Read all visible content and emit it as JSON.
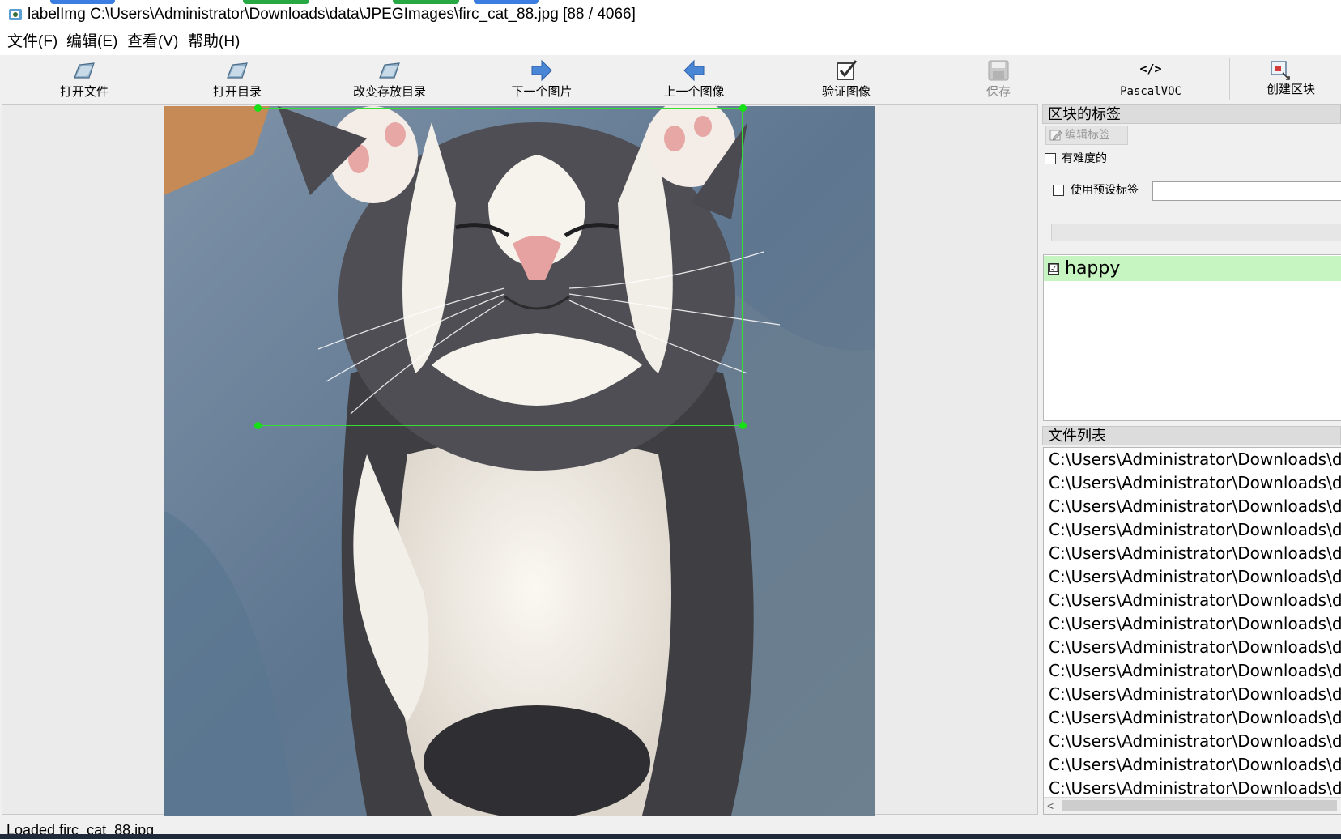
{
  "window": {
    "title": "labelImg C:\\Users\\Administrator\\Downloads\\data\\JPEGImages\\firc_cat_88.jpg [88 / 4066]",
    "app_icon": "labelimg-app-icon"
  },
  "menu": [
    {
      "label": "文件(F)"
    },
    {
      "label": "编辑(E)"
    },
    {
      "label": "查看(V)"
    },
    {
      "label": "帮助(H)"
    }
  ],
  "toolbar": {
    "open_file": {
      "label": "打开文件",
      "icon": "folder-open-icon"
    },
    "open_dir": {
      "label": "打开目录",
      "icon": "folder-open-icon"
    },
    "change_save_dir": {
      "label": "改变存放目录",
      "icon": "folder-open-icon"
    },
    "next_image": {
      "label": "下一个图片",
      "icon": "arrow-right-icon"
    },
    "prev_image": {
      "label": "上一个图像",
      "icon": "arrow-left-icon"
    },
    "verify_image": {
      "label": "验证图像",
      "icon": "checkbox-check-icon"
    },
    "save": {
      "label": "保存",
      "icon": "floppy-disk-icon",
      "enabled": false
    },
    "format": {
      "label": "PascalVOC",
      "icon_text": "</>",
      "icon": "code-icon"
    },
    "create_box": {
      "label": "创建区块",
      "icon": "create-rect-icon"
    }
  },
  "box_labels_panel": {
    "title": "区块的标签",
    "edit_label_button": "编辑标签",
    "difficult_label": "有难度的",
    "difficult_checked": false,
    "use_default_label": "使用预设标签",
    "use_default_checked": false,
    "default_label_value": "",
    "labels": [
      {
        "name": "happy",
        "checked": true,
        "checkmark": "☑"
      }
    ]
  },
  "file_list_panel": {
    "title": "文件列表",
    "items": [
      "C:\\Users\\Administrator\\Downloads\\da",
      "C:\\Users\\Administrator\\Downloads\\da",
      "C:\\Users\\Administrator\\Downloads\\da",
      "C:\\Users\\Administrator\\Downloads\\da",
      "C:\\Users\\Administrator\\Downloads\\da",
      "C:\\Users\\Administrator\\Downloads\\da",
      "C:\\Users\\Administrator\\Downloads\\da",
      "C:\\Users\\Administrator\\Downloads\\da",
      "C:\\Users\\Administrator\\Downloads\\da",
      "C:\\Users\\Administrator\\Downloads\\da",
      "C:\\Users\\Administrator\\Downloads\\da",
      "C:\\Users\\Administrator\\Downloads\\da",
      "C:\\Users\\Administrator\\Downloads\\da",
      "C:\\Users\\Administrator\\Downloads\\da",
      "C:\\Users\\Administrator\\Downloads\\da"
    ],
    "scroll_left_arrow": "<"
  },
  "status": {
    "text": "Loaded firc_cat_88.jpg"
  },
  "colors": {
    "bbox": "#35e035",
    "label_highlight": "#c6f5c2",
    "toolbar_arrow": "#4a86d6"
  }
}
